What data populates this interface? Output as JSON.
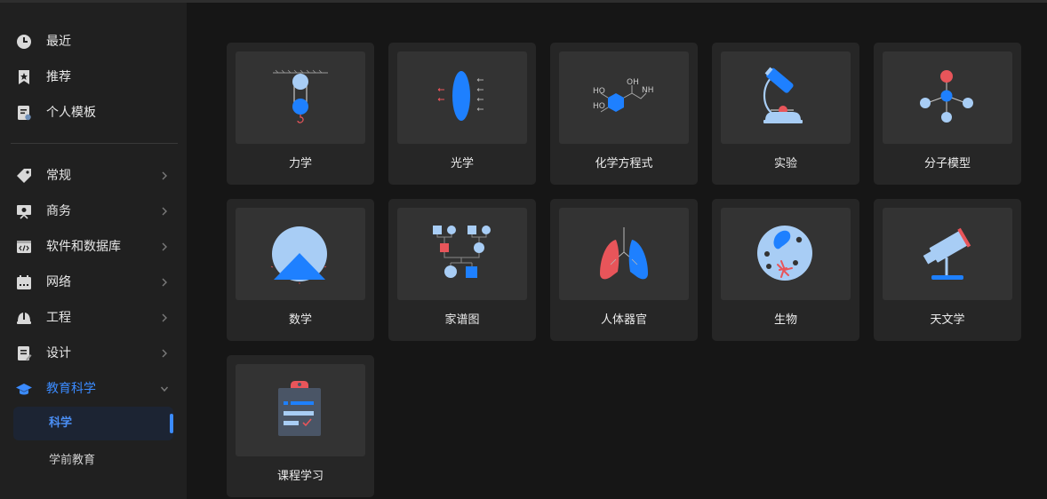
{
  "sidebar": {
    "top_items": [
      {
        "label": "最近",
        "icon": "clock-icon"
      },
      {
        "label": "推荐",
        "icon": "star-bookmark-icon"
      },
      {
        "label": "个人模板",
        "icon": "personal-template-icon"
      }
    ],
    "categories": [
      {
        "label": "常规",
        "icon": "tag-icon"
      },
      {
        "label": "商务",
        "icon": "presentation-board-icon"
      },
      {
        "label": "软件和数据库",
        "icon": "code-window-icon"
      },
      {
        "label": "网络",
        "icon": "network-icon"
      },
      {
        "label": "工程",
        "icon": "hard-hat-icon"
      },
      {
        "label": "设计",
        "icon": "design-doc-icon"
      },
      {
        "label": "教育科学",
        "icon": "graduation-cap-icon"
      }
    ],
    "subitems": [
      {
        "label": "科学",
        "selected": true
      },
      {
        "label": "学前教育",
        "selected": false
      }
    ],
    "accent_color": "#3b8bff"
  },
  "templates": [
    {
      "title": "力学",
      "icon": "pulley-mechanics-icon"
    },
    {
      "title": "光学",
      "icon": "lens-optics-icon"
    },
    {
      "title": "化学方程式",
      "icon": "chemical-structure-icon"
    },
    {
      "title": "实验",
      "icon": "microscope-icon"
    },
    {
      "title": "分子模型",
      "icon": "molecule-icon"
    },
    {
      "title": "数学",
      "icon": "geometry-shapes-icon"
    },
    {
      "title": "家谱图",
      "icon": "family-tree-icon"
    },
    {
      "title": "人体器官",
      "icon": "lungs-icon"
    },
    {
      "title": "生物",
      "icon": "cell-icon"
    },
    {
      "title": "天文学",
      "icon": "telescope-icon"
    },
    {
      "title": "课程学习",
      "icon": "clipboard-checklist-icon"
    }
  ],
  "chem_labels": {
    "ho1": "HO",
    "oh": "OH",
    "nh": "NH",
    "ho2": "HO"
  }
}
